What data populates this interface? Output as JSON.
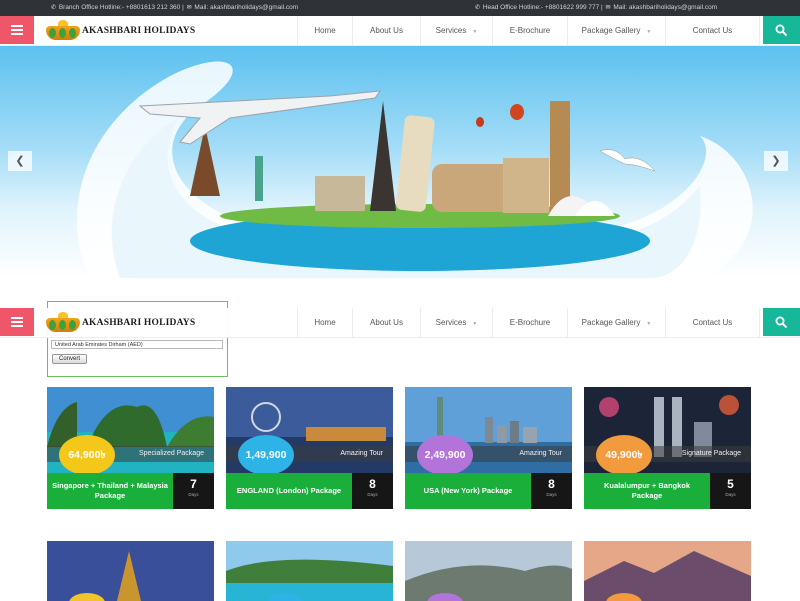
{
  "topbar": {
    "branch": "Branch Office Hotline:- +8801613 212 360 |",
    "branch_mail": "Mail: akashbariholidays@gmail.com",
    "head": "Head Office Hotline:- +8801622 999 777 |",
    "head_mail": "Mail: akashbariholidays@gmail.com"
  },
  "logo": {
    "text": "AKASHBARI HOLIDAYS"
  },
  "nav": [
    {
      "label": "Home",
      "caret": false
    },
    {
      "label": "About Us",
      "caret": false
    },
    {
      "label": "Services",
      "caret": true
    },
    {
      "label": "E-Brochure",
      "caret": false
    },
    {
      "label": "Package Gallery",
      "caret": true
    },
    {
      "label": "Contact Us",
      "caret": false
    }
  ],
  "converter": {
    "select_value": "United Arab Emirates Dirham (AED)",
    "button": "Convert"
  },
  "packages": [
    {
      "price": "64,900৳",
      "tag": "Specialized Package",
      "title": "Singapore + Thailand + Malaysia Package",
      "days": "7",
      "days_label": "Days",
      "price_color": "#f4c81b"
    },
    {
      "price": "1,49,900",
      "tag": "Amazing Tour",
      "title": "ENGLAND (London) Package",
      "days": "8",
      "days_label": "Days",
      "price_color": "#2db3e6"
    },
    {
      "price": "2,49,900",
      "tag": "Amazing Tour",
      "title": "USA (New York) Package",
      "days": "8",
      "days_label": "Days",
      "price_color": "#b374d9"
    },
    {
      "price": "49,900৳",
      "tag": "Signature Package",
      "title": "Kualalumpur + Bangkok Package",
      "days": "5",
      "days_label": "Days",
      "price_color": "#f19a3e"
    }
  ],
  "colors": {
    "accent_red": "#f0566a",
    "accent_teal": "#17b79a",
    "card_green": "#1aae3a"
  }
}
